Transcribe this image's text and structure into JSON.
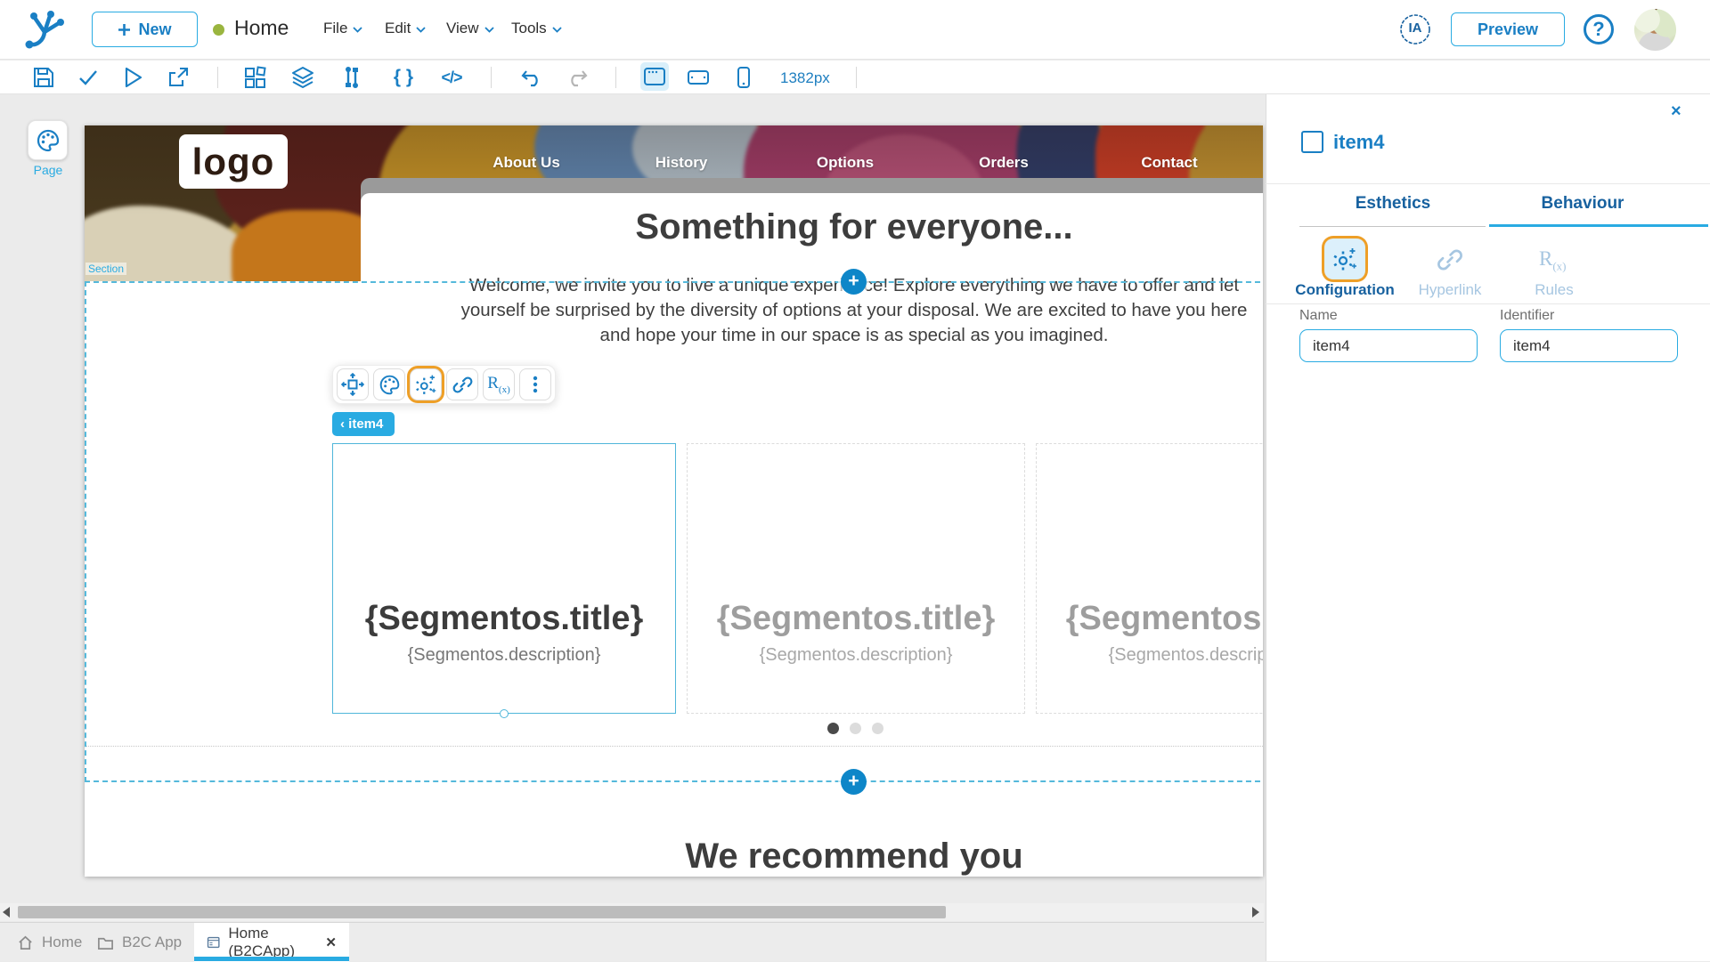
{
  "colors": {
    "accent_cyan": "#29abe2",
    "primary_blue": "#1a7fc4",
    "dark_blue": "#17619f",
    "highlight_orange": "#ee9f27",
    "muted_blue": "#a6c6e1",
    "selection_teal": "#55b9db",
    "status_green": "#9ab53f",
    "text_dark": "#3e3e3e"
  },
  "header": {
    "logo_icon": "branch-logo-icon",
    "new_button": "New",
    "title": "Home",
    "menus": [
      {
        "label": "File"
      },
      {
        "label": "Edit"
      },
      {
        "label": "View"
      },
      {
        "label": "Tools"
      }
    ],
    "ia_badge": "IA",
    "preview_button": "Preview",
    "help_button": "?"
  },
  "toolbar": {
    "icons": [
      "save-icon",
      "check-icon",
      "run-icon",
      "publish-icon",
      "widgets-grid-icon",
      "layers-icon",
      "flows-icon",
      "braces-icon",
      "code-icon",
      "undo-icon",
      "redo-icon",
      "desktop-view-icon",
      "tablet-view-icon",
      "phone-view-icon"
    ],
    "width_indicator": "1382px"
  },
  "left_rail": {
    "page_label": "Page"
  },
  "canvas": {
    "section_label": "Section",
    "selected_widget_tag": "‹  item4",
    "widget_toolbar_icons": [
      "move-icon",
      "palette-icon",
      "gear-sparkle-icon",
      "link-icon",
      "rules-rx-icon",
      "more-dots-icon"
    ],
    "site": {
      "logo_text": "logo",
      "nav": [
        "About Us",
        "History",
        "Options",
        "Orders",
        "Contact"
      ],
      "hero_heading": "Something for everyone...",
      "paragraph_lines": [
        "Welcome, we invite you to live a unique experience! Explore everything we have to offer and let",
        "yourself be surprised by the diversity of options at your disposal. We are excited to have you here",
        "and hope your time in our space is as special as you imagined."
      ],
      "carousel": {
        "cards": [
          {
            "title": "{Segmentos.title}",
            "description": "{Segmentos.description}"
          },
          {
            "title": "{Segmentos.title}",
            "description": "{Segmentos.description}"
          },
          {
            "title": "{Segmentos.title}",
            "description": "{Segmentos.description}"
          }
        ],
        "active_dot_index": 0
      },
      "next_heading": "We recommend you"
    }
  },
  "properties_panel": {
    "close_icon": "×",
    "widget_name": "item4",
    "tabs": [
      {
        "label": "Esthetics",
        "active": false
      },
      {
        "label": "Behaviour",
        "active": true
      }
    ],
    "subtabs": [
      {
        "label": "Configuration",
        "icon": "gear-sparkle-icon",
        "active": true
      },
      {
        "label": "Hyperlink",
        "icon": "link-icon",
        "active": false
      },
      {
        "label": "Rules",
        "icon": "rules-rx-icon",
        "active": false
      }
    ],
    "fields": [
      {
        "label": "Name",
        "value": "item4"
      },
      {
        "label": "Identifier",
        "value": "item4"
      }
    ]
  },
  "bottom_tabs": [
    {
      "label": "Home",
      "icon": "home-icon",
      "closable": false,
      "active": false
    },
    {
      "label": "B2C App",
      "icon": "folder-icon",
      "closable": true,
      "active": false
    },
    {
      "label": "Home (B2CApp)",
      "icon": "window-icon",
      "closable": true,
      "active": true
    }
  ],
  "close_glyph": "✕"
}
